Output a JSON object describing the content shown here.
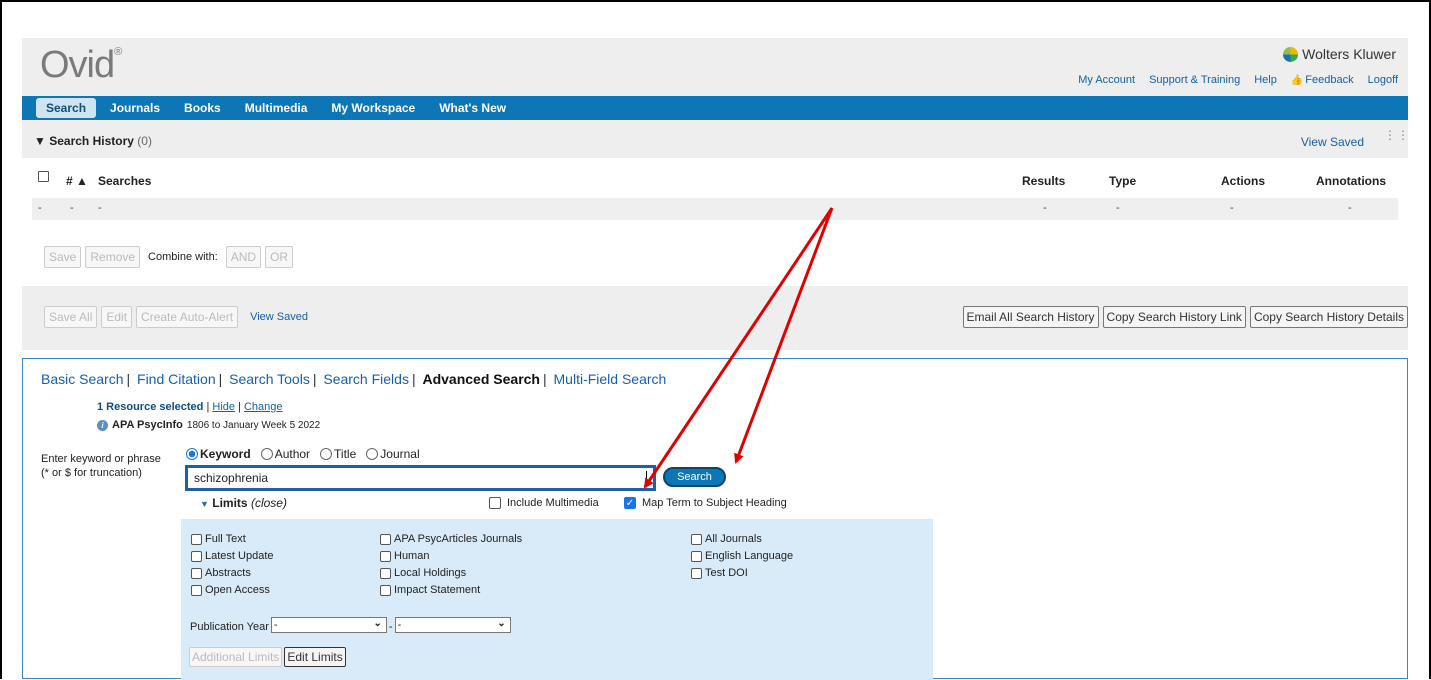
{
  "header": {
    "logo": "Ovid",
    "logo_mark": "®",
    "brand": "Wolters Kluwer",
    "links": [
      "My Account",
      "Support & Training",
      "Help",
      "Feedback",
      "Logoff"
    ]
  },
  "nav": [
    "Search",
    "Journals",
    "Books",
    "Multimedia",
    "My Workspace",
    "What's New"
  ],
  "history": {
    "title": "Search History",
    "count": "(0)",
    "view_saved": "View Saved",
    "columns": {
      "num": "#",
      "searches": "Searches",
      "results": "Results",
      "type": "Type",
      "actions": "Actions",
      "annotations": "Annotations"
    },
    "empty_row": {
      "a": "-",
      "b": "-",
      "c": "-",
      "results": "-",
      "type": "-",
      "actions": "-",
      "annotations": "-"
    },
    "buttons": {
      "save": "Save",
      "remove": "Remove",
      "combine_label": "Combine with:",
      "and": "AND",
      "or": "OR"
    },
    "footer": {
      "save_all": "Save All",
      "edit": "Edit",
      "auto_alert": "Create Auto-Alert",
      "view_saved": "View Saved",
      "email_all": "Email All Search History",
      "copy_link": "Copy Search History Link",
      "copy_details": "Copy Search History Details"
    }
  },
  "search": {
    "tabs": [
      "Basic Search",
      "Find Citation",
      "Search Tools",
      "Search Fields",
      "Advanced Search",
      "Multi-Field Search"
    ],
    "active_tab": "Advanced Search",
    "resource_selected": "1 Resource selected",
    "hide": "Hide",
    "change": "Change",
    "db_name": "APA PsycInfo",
    "db_range": "1806 to January Week 5 2022",
    "prompt_line1": "Enter keyword or phrase",
    "prompt_line2": "(* or $ for truncation)",
    "radios": [
      "Keyword",
      "Author",
      "Title",
      "Journal"
    ],
    "selected_radio": "Keyword",
    "query": "schizophrenia",
    "search_button": "Search",
    "limits_label": "Limits",
    "limits_close": "(close)",
    "include_multimedia": "Include Multimedia",
    "map_term": "Map Term to Subject Heading",
    "map_term_checked": true,
    "limits_col1": [
      "Full Text",
      "Latest Update",
      "Abstracts",
      "Open Access"
    ],
    "limits_col2": [
      "APA PsycArticles Journals",
      "Human",
      "Local Holdings",
      "Impact Statement"
    ],
    "limits_col3": [
      "All Journals",
      "English Language",
      "Test DOI"
    ],
    "pub_year_label": "Publication Year",
    "pub_year_from": "-",
    "pub_year_to": "-",
    "additional_limits": "Additional Limits",
    "edit_limits": "Edit Limits"
  },
  "colors": {
    "nav_blue": "#0c76b7",
    "annotation_red": "#e00000",
    "link_blue": "#1460aa"
  }
}
